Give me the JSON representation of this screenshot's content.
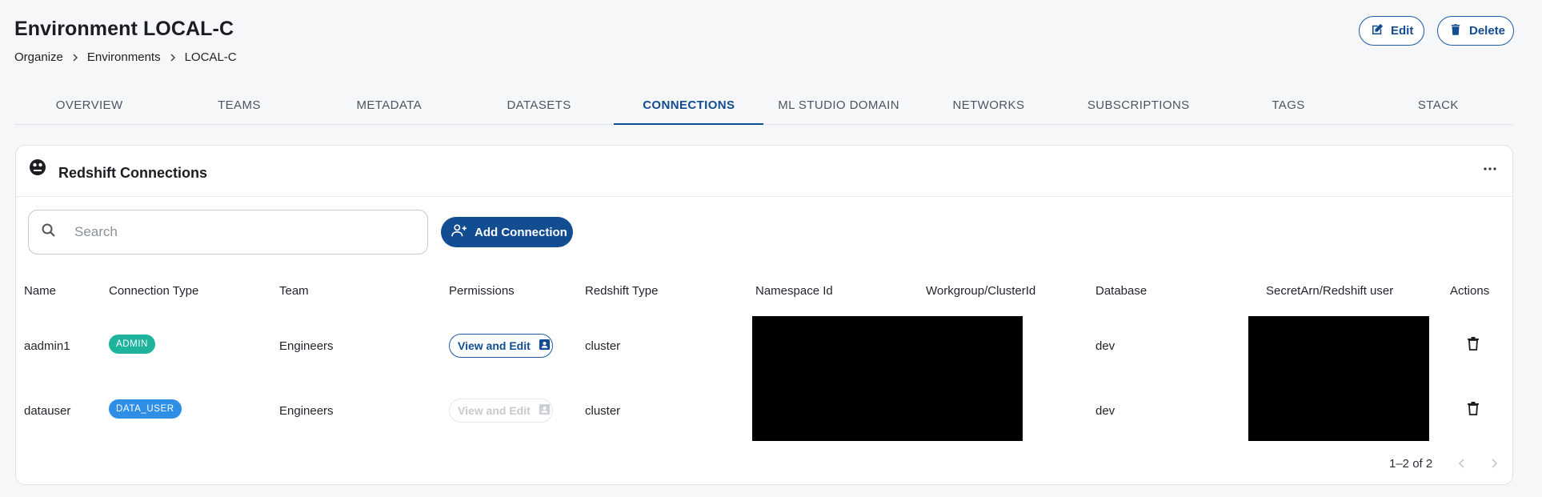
{
  "page": {
    "title": "Environment LOCAL-C",
    "breadcrumb": [
      "Organize",
      "Environments",
      "LOCAL-C"
    ],
    "edit_label": "Edit",
    "delete_label": "Delete"
  },
  "tabs": [
    {
      "label": "OVERVIEW"
    },
    {
      "label": "TEAMS"
    },
    {
      "label": "METADATA"
    },
    {
      "label": "DATASETS"
    },
    {
      "label": "CONNECTIONS",
      "active": true
    },
    {
      "label": "ML STUDIO DOMAIN"
    },
    {
      "label": "NETWORKS"
    },
    {
      "label": "SUBSCRIPTIONS"
    },
    {
      "label": "TAGS"
    },
    {
      "label": "STACK"
    }
  ],
  "card": {
    "title": "Redshift Connections",
    "icon": "redshift-icon",
    "search_placeholder": "Search",
    "search_value": "",
    "add_label": "Add Connection"
  },
  "table": {
    "columns": [
      "Name",
      "Connection Type",
      "Team",
      "Permissions",
      "Redshift Type",
      "Namespace Id",
      "Workgroup/ClusterId",
      "Database",
      "SecretArn/Redshift user",
      "Actions"
    ],
    "rows": [
      {
        "name": "aadmin1",
        "connection_type": "ADMIN",
        "team": "Engineers",
        "permission": "View and Edit",
        "permission_enabled": true,
        "redshift_type": "cluster",
        "database": "dev"
      },
      {
        "name": "datauser",
        "connection_type": "DATA_USER",
        "team": "Engineers",
        "permission": "View and Edit",
        "permission_enabled": false,
        "redshift_type": "cluster",
        "database": "dev"
      }
    ]
  },
  "pagination": {
    "label": "1–2 of 2"
  },
  "colors": {
    "primary": "#124c91",
    "admin_badge": "#1db39c",
    "data_user_badge": "#2f8fe6"
  }
}
